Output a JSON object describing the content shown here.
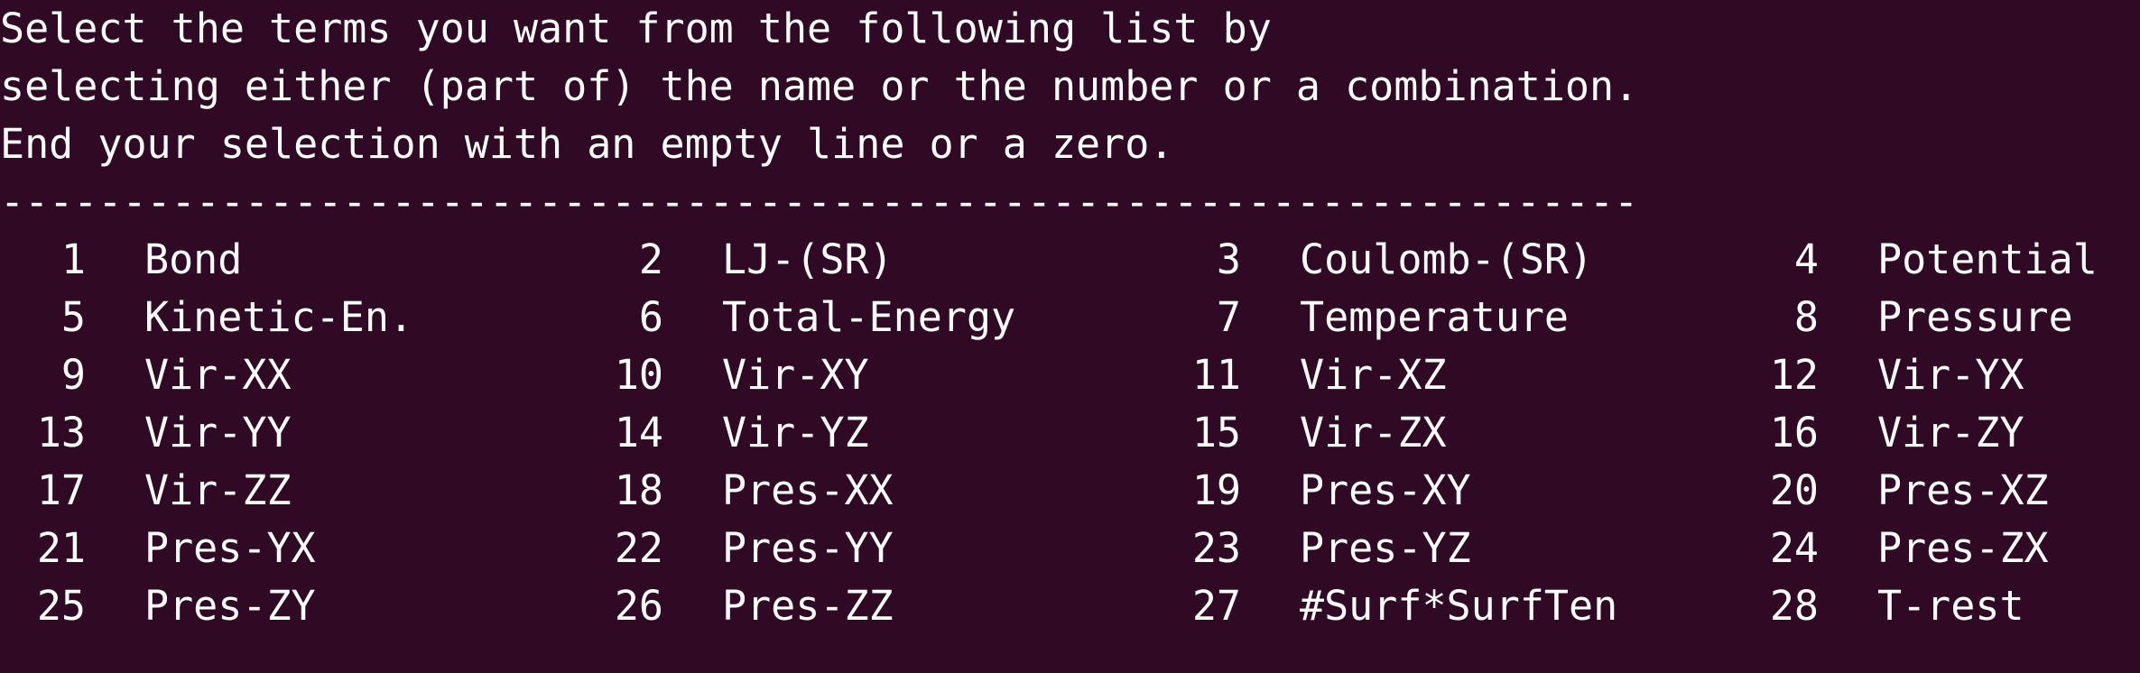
{
  "instructions": [
    "Select the terms you want from the following list by",
    "selecting either (part of) the name or the number or a combination.",
    "End your selection with an empty line or a zero."
  ],
  "separator": "-------------------------------------------------------------------",
  "terms": [
    [
      {
        "num": "1",
        "name": "Bond"
      },
      {
        "num": "2",
        "name": "LJ-(SR)"
      },
      {
        "num": "3",
        "name": "Coulomb-(SR)"
      },
      {
        "num": "4",
        "name": "Potential"
      }
    ],
    [
      {
        "num": "5",
        "name": "Kinetic-En."
      },
      {
        "num": "6",
        "name": "Total-Energy"
      },
      {
        "num": "7",
        "name": "Temperature"
      },
      {
        "num": "8",
        "name": "Pressure"
      }
    ],
    [
      {
        "num": "9",
        "name": "Vir-XX"
      },
      {
        "num": "10",
        "name": "Vir-XY"
      },
      {
        "num": "11",
        "name": "Vir-XZ"
      },
      {
        "num": "12",
        "name": "Vir-YX"
      }
    ],
    [
      {
        "num": "13",
        "name": "Vir-YY"
      },
      {
        "num": "14",
        "name": "Vir-YZ"
      },
      {
        "num": "15",
        "name": "Vir-ZX"
      },
      {
        "num": "16",
        "name": "Vir-ZY"
      }
    ],
    [
      {
        "num": "17",
        "name": "Vir-ZZ"
      },
      {
        "num": "18",
        "name": "Pres-XX"
      },
      {
        "num": "19",
        "name": "Pres-XY"
      },
      {
        "num": "20",
        "name": "Pres-XZ"
      }
    ],
    [
      {
        "num": "21",
        "name": "Pres-YX"
      },
      {
        "num": "22",
        "name": "Pres-YY"
      },
      {
        "num": "23",
        "name": "Pres-YZ"
      },
      {
        "num": "24",
        "name": "Pres-ZX"
      }
    ],
    [
      {
        "num": "25",
        "name": "Pres-ZY"
      },
      {
        "num": "26",
        "name": "Pres-ZZ"
      },
      {
        "num": "27",
        "name": "#Surf*SurfTen"
      },
      {
        "num": "28",
        "name": "T-rest"
      }
    ]
  ],
  "colors": {
    "background": "#300a24",
    "foreground": "#ffffff"
  }
}
